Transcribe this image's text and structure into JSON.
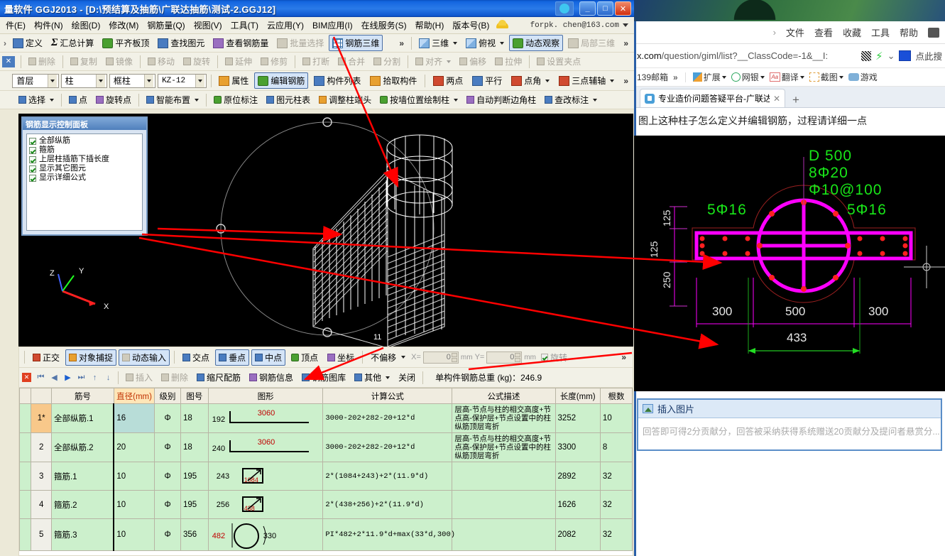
{
  "window": {
    "title": "量软件 GGJ2013 - [D:\\预结算及抽筋\\广联达抽筋\\测试-2.GGJ12]",
    "minimize": "_",
    "maximize": "□",
    "close": "✕"
  },
  "menubar": {
    "items": [
      "件(E)",
      "构件(N)",
      "绘图(D)",
      "修改(M)",
      "钢筋量(Q)",
      "视图(V)",
      "工具(T)",
      "云应用(Y)",
      "BIM应用(I)",
      "在线服务(S)",
      "帮助(H)",
      "版本号(B)"
    ],
    "account": "forpk. chen@163.com"
  },
  "toolbar_main": {
    "items": [
      {
        "label": "定义",
        "icon": "define-icon",
        "enabled": true
      },
      {
        "label": "汇总计算",
        "icon": "sigma-icon",
        "enabled": true
      },
      {
        "label": "平齐板顶",
        "icon": "align-slab-icon",
        "enabled": true
      },
      {
        "label": "查找图元",
        "icon": "binoculars-icon",
        "enabled": true
      },
      {
        "label": "查看钢筋量",
        "icon": "view-rebar-icon",
        "enabled": true
      },
      {
        "label": "批量选择",
        "icon": "batch-select-icon",
        "enabled": false
      },
      {
        "label": "钢筋三维",
        "icon": "rebar-3d-icon",
        "enabled": true,
        "active": true
      }
    ],
    "view_buttons": [
      {
        "label": "三维",
        "icon": "cube-icon"
      },
      {
        "label": "俯视",
        "icon": "top-view-icon"
      },
      {
        "label": "动态观察",
        "icon": "orbit-icon",
        "active": true
      },
      {
        "label": "局部三维",
        "icon": "local-3d-icon",
        "enabled": false
      }
    ],
    "overflow": "»"
  },
  "toolbar_edit": {
    "items": [
      {
        "label": "删除",
        "icon": "delete-icon"
      },
      {
        "label": "复制",
        "icon": "copy-icon"
      },
      {
        "label": "镜像",
        "icon": "mirror-icon"
      },
      {
        "label": "移动",
        "icon": "move-icon"
      },
      {
        "label": "旋转",
        "icon": "rotate-icon"
      },
      {
        "label": "延伸",
        "icon": "extend-icon"
      },
      {
        "label": "修剪",
        "icon": "trim-icon"
      },
      {
        "label": "打断",
        "icon": "break-icon"
      },
      {
        "label": "合并",
        "icon": "merge-icon"
      },
      {
        "label": "分割",
        "icon": "split-icon"
      },
      {
        "label": "对齐",
        "icon": "align-icon",
        "dropdown": true
      },
      {
        "label": "偏移",
        "icon": "offset-icon"
      },
      {
        "label": "拉伸",
        "icon": "stretch-icon"
      },
      {
        "label": "设置夹点",
        "icon": "grip-icon"
      }
    ],
    "close": "✕"
  },
  "selectors": {
    "floor": "首层",
    "category": "柱",
    "type": "框柱",
    "member": "KZ-12",
    "buttons": [
      {
        "label": "属性",
        "icon": "properties-icon"
      },
      {
        "label": "编辑钢筋",
        "icon": "edit-rebar-icon",
        "active": true
      },
      {
        "label": "构件列表",
        "icon": "member-list-icon"
      },
      {
        "label": "拾取构件",
        "icon": "pick-member-icon"
      },
      {
        "label": "两点",
        "icon": "two-point-icon"
      },
      {
        "label": "平行",
        "icon": "parallel-icon"
      },
      {
        "label": "点角",
        "icon": "point-angle-icon",
        "dropdown": true
      },
      {
        "label": "三点辅轴",
        "icon": "three-point-axis-icon",
        "dropdown": true
      }
    ]
  },
  "toolbar_draw": {
    "items": [
      {
        "label": "选择",
        "icon": "cursor-icon",
        "dropdown": true
      },
      {
        "label": "点",
        "icon": "point-icon"
      },
      {
        "label": "旋转点",
        "icon": "rotate-point-icon"
      },
      {
        "label": "智能布置",
        "icon": "smart-layout-icon",
        "dropdown": true
      },
      {
        "label": "原位标注",
        "icon": "in-situ-label-icon"
      },
      {
        "label": "图元柱表",
        "icon": "column-table-icon"
      },
      {
        "label": "调整柱端头",
        "icon": "adjust-column-end-icon"
      },
      {
        "label": "按墙位置绘制柱",
        "icon": "draw-column-wall-icon",
        "dropdown": true
      },
      {
        "label": "自动判断边角柱",
        "icon": "auto-corner-column-icon"
      },
      {
        "label": "查改标注",
        "icon": "check-label-icon",
        "dropdown": true
      }
    ]
  },
  "rebar_panel": {
    "title": "钢筋显示控制面板",
    "options": [
      {
        "label": "全部纵筋",
        "checked": true
      },
      {
        "label": "箍筋",
        "checked": true
      },
      {
        "label": "上层柱插筋下插长度",
        "checked": true
      },
      {
        "label": "显示其它图元",
        "checked": true
      },
      {
        "label": "显示详细公式",
        "checked": true
      }
    ],
    "axis": {
      "x": "X",
      "y": "Y",
      "z": "Z"
    }
  },
  "snapbar": {
    "toggles": [
      {
        "label": "正交",
        "icon": "ortho-icon",
        "active": false
      },
      {
        "label": "对象捕捉",
        "icon": "osnap-icon",
        "active": true
      },
      {
        "label": "动态输入",
        "icon": "dyn-input-icon",
        "active": true
      }
    ],
    "snaps": [
      {
        "label": "交点",
        "icon": "intersection-icon",
        "active": false
      },
      {
        "label": "垂点",
        "icon": "perpendicular-icon",
        "active": true
      },
      {
        "label": "中点",
        "icon": "midpoint-icon",
        "active": true
      },
      {
        "label": "顶点",
        "icon": "vertex-icon",
        "active": false
      },
      {
        "label": "坐标",
        "icon": "coordinate-icon",
        "active": false
      }
    ],
    "offset_mode": "不偏移",
    "x_label": "X=",
    "x_value": "0",
    "x_unit": "mm",
    "y_label": "Y=",
    "y_value": "0",
    "y_unit": "mm",
    "rotate_label": "旋转",
    "overflow": "»"
  },
  "navbar": {
    "nav_icons": [
      "first-record-icon",
      "prev-record-icon",
      "next-record-icon",
      "last-record-icon",
      "move-up-icon",
      "move-down-icon"
    ],
    "buttons": [
      {
        "label": "插入",
        "icon": "insert-row-icon",
        "enabled": false
      },
      {
        "label": "删除",
        "icon": "delete-row-icon",
        "enabled": false
      },
      {
        "label": "缩尺配筋",
        "icon": "scale-rebar-icon",
        "enabled": true
      },
      {
        "label": "钢筋信息",
        "icon": "rebar-info-icon",
        "enabled": true
      },
      {
        "label": "钢筋图库",
        "icon": "rebar-library-icon",
        "enabled": true
      },
      {
        "label": "其他",
        "icon": "other-icon",
        "enabled": true,
        "dropdown": true
      },
      {
        "label": "关闭",
        "icon": "close-grid-icon",
        "enabled": true
      }
    ],
    "total_weight": "单构件钢筋总重 (kg)：246.9"
  },
  "table": {
    "headers": [
      "",
      "筋号",
      "直径(mm)",
      "级别",
      "图号",
      "图形",
      "计算公式",
      "公式描述",
      "长度(mm)",
      "根数"
    ],
    "highlight_header": "直径(mm)",
    "rows": [
      {
        "num": "1*",
        "selected": true,
        "name": "全部纵筋.1",
        "diameter": "16",
        "grade": "Φ",
        "figure_no": "18",
        "fig": {
          "type": "hook-bar",
          "left": "192",
          "top": "3060"
        },
        "formula": "3000-202+282-20+12*d",
        "description": "层高-节点与柱的相交高度+节点高-保护层+节点设置中的柱纵筋顶层弯折",
        "length": "3252",
        "count": "10"
      },
      {
        "num": "2",
        "selected": false,
        "name": "全部纵筋.2",
        "diameter": "20",
        "grade": "Φ",
        "figure_no": "18",
        "fig": {
          "type": "hook-bar",
          "left": "240",
          "top": "3060"
        },
        "formula": "3000-202+282-20+12*d",
        "description": "层高-节点与柱的相交高度+节点高-保护层+节点设置中的柱纵筋顶层弯折",
        "length": "3300",
        "count": "8"
      },
      {
        "num": "3",
        "selected": false,
        "name": "箍筋.1",
        "diameter": "10",
        "grade": "Φ",
        "figure_no": "195",
        "fig": {
          "type": "stirrup-box",
          "left": "243",
          "inner": "1084"
        },
        "formula": "2*(1084+243)+2*(11.9*d)",
        "description": "",
        "length": "2892",
        "count": "32"
      },
      {
        "num": "4",
        "selected": false,
        "name": "箍筋.2",
        "diameter": "10",
        "grade": "Φ",
        "figure_no": "195",
        "fig": {
          "type": "stirrup-box",
          "left": "256",
          "inner": "438"
        },
        "formula": "2*(438+256)+2*(11.9*d)",
        "description": "",
        "length": "1626",
        "count": "32"
      },
      {
        "num": "5",
        "selected": false,
        "name": "箍筋.3",
        "diameter": "10",
        "grade": "Φ",
        "figure_no": "356",
        "fig": {
          "type": "circle-stirrup",
          "left": "482",
          "right": "330"
        },
        "formula": "PI*482+2*11.9*d+max(33*d,300)",
        "description": "",
        "length": "2082",
        "count": "32"
      }
    ]
  },
  "browser": {
    "menu": [
      "文件",
      "查看",
      "收藏",
      "工具",
      "帮助"
    ],
    "menu_chevron": "›",
    "url_domain": "x.com",
    "url_path": "/question/giml/list?__ClassCode=-1&__I:",
    "search_hint": "点此搜",
    "bookmarks": [
      "139邮箱",
      "扩展",
      "网银",
      "翻译",
      "截图",
      "游戏"
    ],
    "bookmark_overflow": "»",
    "tab_title": "专业造价问题答疑平台-广联达",
    "tab_close": "✕",
    "new_tab": "+",
    "question": "图上这种柱子怎么定义并编辑钢筋，过程请详细一点"
  },
  "cad": {
    "labels": [
      "D 500",
      "8Φ20",
      "Φ10@100"
    ],
    "left_rebar": "5Φ16",
    "right_rebar": "5Φ16",
    "dim_bottom": [
      "300",
      "500",
      "300"
    ],
    "dim_green": "433",
    "dim_left": [
      "125",
      "250",
      "125"
    ]
  },
  "answer_box": {
    "insert_image": "插入图片",
    "placeholder": "回答即可得2分贡献分，回答被采纳获得系统赠送20贡献分及提问者悬赏分..."
  },
  "colors": {
    "accent": "#1466e0",
    "table_row": "#ccf0cc",
    "selected_row": "#f8c88a",
    "highlight_header": "#ffe6b8",
    "cad_green": "#19e619",
    "cad_magenta": "#ff00ff",
    "annotation_red": "#ff0000"
  }
}
